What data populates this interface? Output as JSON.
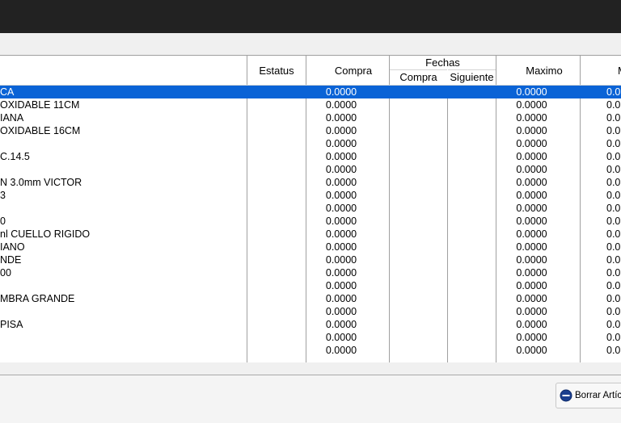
{
  "header": {
    "estatus": "Estatus",
    "compra": "Compra",
    "fechas": "Fechas",
    "fechas_compra": "Compra",
    "fechas_siguiente": "Siguiente",
    "maximo": "Maximo",
    "next_col_partial": "M"
  },
  "rows": [
    {
      "desc": "CA",
      "compra": "0.0000",
      "maximo": "0.0000",
      "extra": "0.0",
      "selected": true
    },
    {
      "desc": "OXIDABLE 11CM",
      "compra": "0.0000",
      "maximo": "0.0000",
      "extra": "0.0"
    },
    {
      "desc": "IANA",
      "compra": "0.0000",
      "maximo": "0.0000",
      "extra": "0.0"
    },
    {
      "desc": "OXIDABLE 16CM",
      "compra": "0.0000",
      "maximo": "0.0000",
      "extra": "0.0"
    },
    {
      "desc": "",
      "compra": "0.0000",
      "maximo": "0.0000",
      "extra": "0.0"
    },
    {
      "desc": "C.14.5",
      "compra": "0.0000",
      "maximo": "0.0000",
      "extra": "0.0"
    },
    {
      "desc": "",
      "compra": "0.0000",
      "maximo": "0.0000",
      "extra": "0.0"
    },
    {
      "desc": "N 3.0mm VICTOR",
      "compra": "0.0000",
      "maximo": "0.0000",
      "extra": "0.0"
    },
    {
      "desc": "3",
      "compra": "0.0000",
      "maximo": "0.0000",
      "extra": "0.0"
    },
    {
      "desc": "",
      "compra": "0.0000",
      "maximo": "0.0000",
      "extra": "0.0"
    },
    {
      "desc": "0",
      "compra": "0.0000",
      "maximo": "0.0000",
      "extra": "0.0"
    },
    {
      "desc": "nl CUELLO RIGIDO",
      "compra": "0.0000",
      "maximo": "0.0000",
      "extra": "0.0"
    },
    {
      "desc": "IANO",
      "compra": "0.0000",
      "maximo": "0.0000",
      "extra": "0.0"
    },
    {
      "desc": "NDE",
      "compra": "0.0000",
      "maximo": "0.0000",
      "extra": "0.0"
    },
    {
      "desc": "00",
      "compra": "0.0000",
      "maximo": "0.0000",
      "extra": "0.0"
    },
    {
      "desc": "",
      "compra": "0.0000",
      "maximo": "0.0000",
      "extra": "0.0"
    },
    {
      "desc": "MBRA GRANDE",
      "compra": "0.0000",
      "maximo": "0.0000",
      "extra": "0.0"
    },
    {
      "desc": "",
      "compra": "0.0000",
      "maximo": "0.0000",
      "extra": "0.0"
    },
    {
      "desc": "PISA",
      "compra": "0.0000",
      "maximo": "0.0000",
      "extra": "0.0"
    },
    {
      "desc": "",
      "compra": "0.0000",
      "maximo": "0.0000",
      "extra": "0.0"
    },
    {
      "desc": "",
      "compra": "0.0000",
      "maximo": "0.0000",
      "extra": "0.0"
    }
  ],
  "footer": {
    "delete_button_label": "Borrar Artícu",
    "delete_icon": "minus-circle-icon"
  },
  "colors": {
    "selection": "#0a63d6",
    "titlebar": "#222222"
  }
}
